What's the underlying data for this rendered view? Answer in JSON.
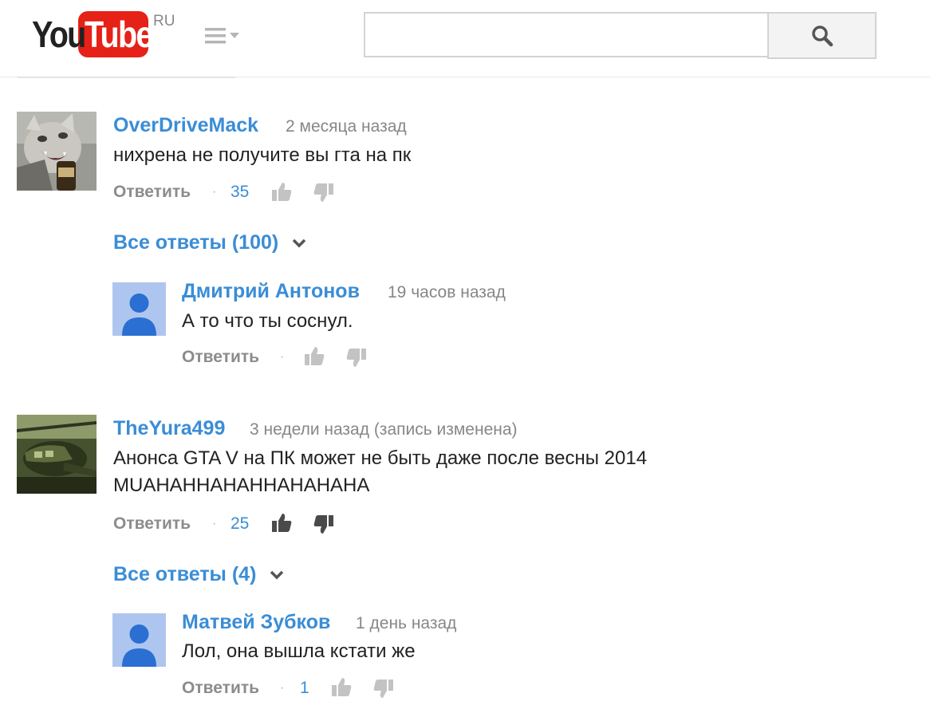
{
  "header": {
    "logo_you": "You",
    "logo_tube": "Tube",
    "logo_region": "RU",
    "search": {
      "value": "",
      "placeholder": ""
    }
  },
  "comments": [
    {
      "author": "OverDriveMack",
      "time": "2 месяца назад",
      "text": "нихрена не получите вы гта на пк",
      "reply_label": "Ответить",
      "likes": "35",
      "all_replies_label": "Все ответы (100)",
      "reply": {
        "author": "Дмитрий Антонов",
        "time": "19 часов назад",
        "text": "А то что ты соснул.",
        "reply_label": "Ответить",
        "likes": ""
      }
    },
    {
      "author": "TheYura499",
      "time": "3 недели назад (запись изменена)",
      "text_lines": [
        "Анонса GTA V на ПК может не быть даже после весны 2014",
        "MUAHAHHAHAHHAHAHAHA"
      ],
      "reply_label": "Ответить",
      "likes": "25",
      "all_replies_label": "Все ответы (4)",
      "reply": {
        "author": "Матвей Зубков",
        "time": "1 день назад",
        "text": "Лол, она вышла кстати же",
        "reply_label": "Ответить",
        "likes": "1"
      }
    }
  ],
  "separator": "·",
  "colors": {
    "link": "#3a8dd6",
    "logo_red": "#e62117",
    "muted": "#878787",
    "default_avatar": "#aec6ef"
  }
}
